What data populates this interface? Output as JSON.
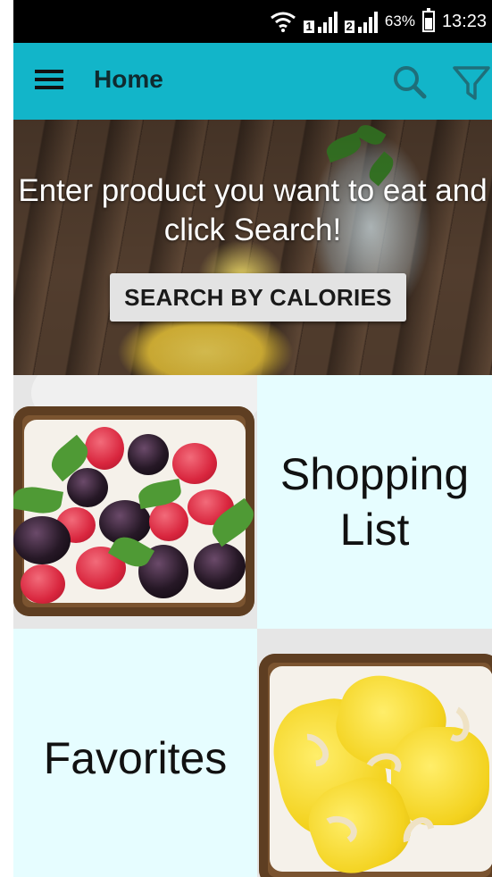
{
  "status_bar": {
    "wifi_icon": "wifi-icon",
    "sim1_label": "1",
    "sim2_label": "2",
    "battery_percent": "63%",
    "time": "13:23"
  },
  "toolbar": {
    "title": "Home",
    "menu_icon": "hamburger-menu-icon",
    "search_icon": "search-icon",
    "filter_icon": "filter-icon",
    "color": "#12b5c9"
  },
  "banner": {
    "text": "Enter product you want to eat and click Search!",
    "button_label": "SEARCH BY CALORIES"
  },
  "tiles": {
    "shopping_list": "Shopping List",
    "favorites": "Favorites",
    "tile_color": "#e6fdff"
  }
}
